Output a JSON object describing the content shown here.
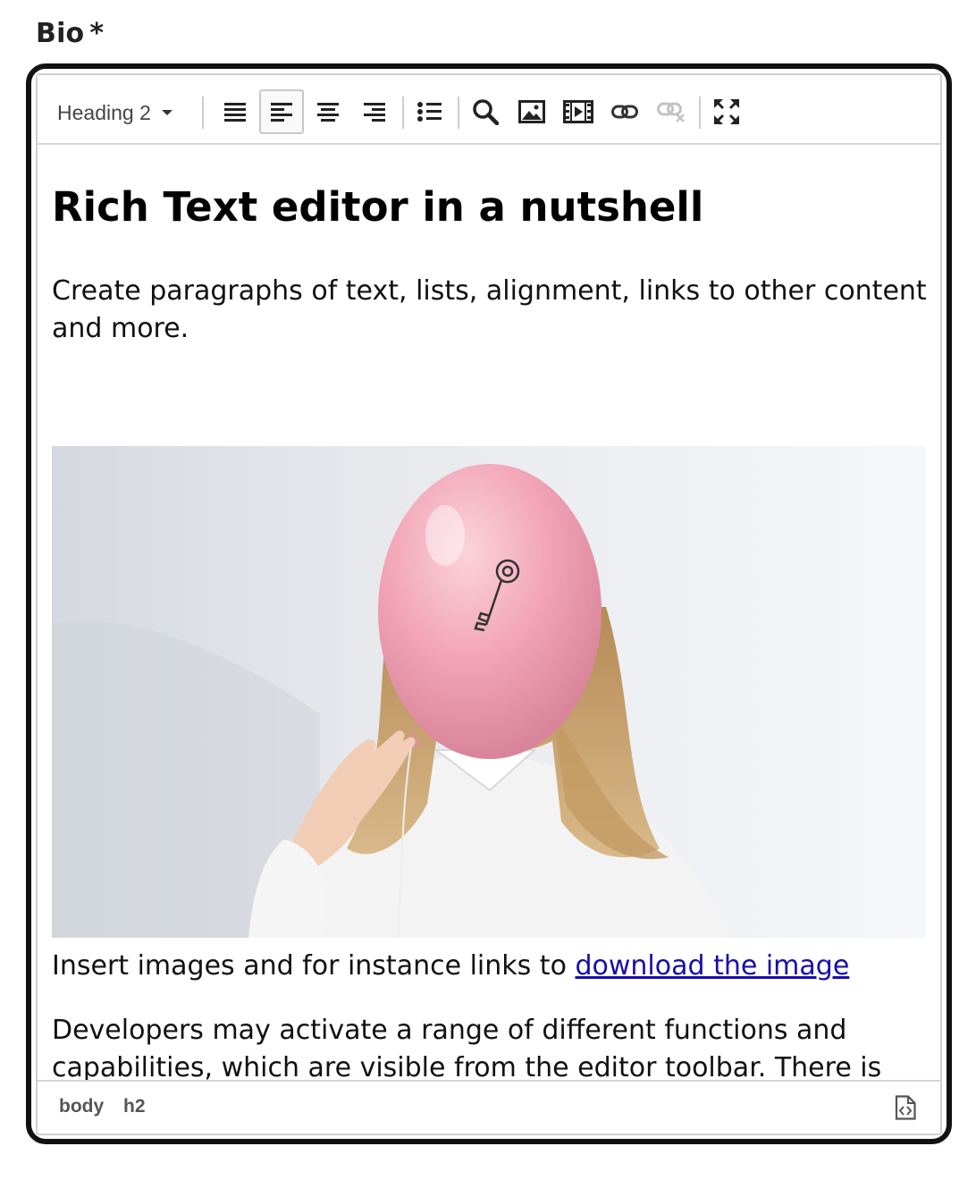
{
  "field": {
    "label": "Bio",
    "required_marker": "*"
  },
  "toolbar": {
    "format_select": "Heading 2",
    "buttons": [
      {
        "name": "justify-icon",
        "active": false
      },
      {
        "name": "align-left-icon",
        "active": true
      },
      {
        "name": "align-center-icon",
        "active": false
      },
      {
        "name": "align-right-icon",
        "active": false
      },
      {
        "name": "bullet-list-icon",
        "active": false
      },
      {
        "name": "search-icon",
        "active": false
      },
      {
        "name": "image-icon",
        "active": false
      },
      {
        "name": "media-icon",
        "active": false
      },
      {
        "name": "link-icon",
        "active": false
      },
      {
        "name": "unlink-icon",
        "active": false,
        "disabled": true
      },
      {
        "name": "fullscreen-icon",
        "active": false
      }
    ]
  },
  "content": {
    "heading": "Rich Text editor in a nutshell",
    "paragraph1": "Create paragraphs of text, lists, alignment, links to other content and more.",
    "caption_text": "Insert images and for instance links to ",
    "caption_link": "download the image",
    "paragraph3": "Developers may activate a range of different functions and capabilities, which are visible from the editor toolbar. There is even a full screen mode, and a source mode for expert users."
  },
  "statusbar": {
    "path": [
      "body",
      "h2"
    ],
    "source_icon": "source-code-icon"
  },
  "colors": {
    "focus_ring": "#111111",
    "border": "#cfcfcf",
    "link": "#1a0dab",
    "balloon": "#f2a9b9"
  }
}
